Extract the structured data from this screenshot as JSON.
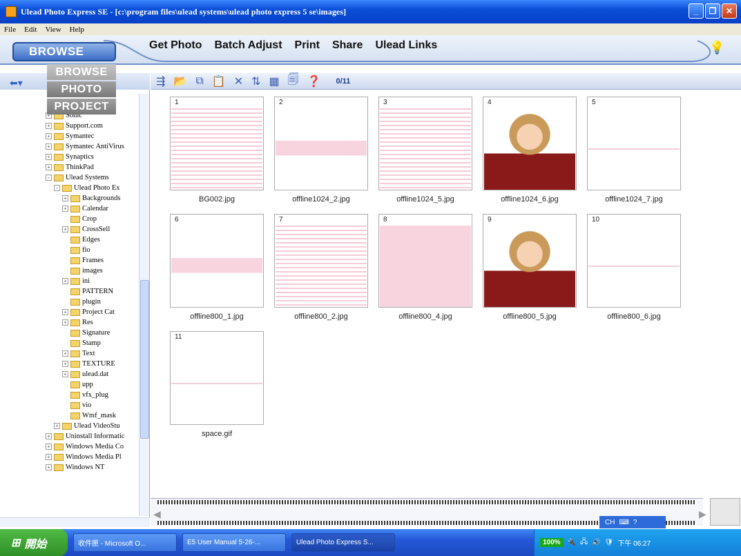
{
  "window": {
    "title": "Ulead Photo Express SE - [c:\\program files\\ulead systems\\ulead photo express 5 se\\images]"
  },
  "menu": [
    "File",
    "Edit",
    "View",
    "Help"
  ],
  "nav": {
    "mode_button": "BROWSE",
    "items": [
      "Get Photo",
      "Batch Adjust",
      "Print",
      "Share",
      "Ulead Links"
    ]
  },
  "mode_menu": [
    "BROWSE",
    "PHOTO",
    "PROJECT"
  ],
  "toolbar": {
    "count": "0/11"
  },
  "tree": [
    {
      "label": "Sonic",
      "indent": 1,
      "pm": "+"
    },
    {
      "label": "Support.com",
      "indent": 1,
      "pm": "+"
    },
    {
      "label": "Symantec",
      "indent": 1,
      "pm": "+"
    },
    {
      "label": "Symantec AntiVirus",
      "indent": 1,
      "pm": "+"
    },
    {
      "label": "Synaptics",
      "indent": 1,
      "pm": "+"
    },
    {
      "label": "ThinkPad",
      "indent": 1,
      "pm": "+"
    },
    {
      "label": "Ulead Systems",
      "indent": 1,
      "pm": "-"
    },
    {
      "label": "Ulead Photo Ex",
      "indent": 2,
      "pm": "-"
    },
    {
      "label": "Backgrounds",
      "indent": 3,
      "pm": "+"
    },
    {
      "label": "Calendar",
      "indent": 3,
      "pm": "+"
    },
    {
      "label": "Crop",
      "indent": 3,
      "pm": ""
    },
    {
      "label": "CrossSell",
      "indent": 3,
      "pm": "+"
    },
    {
      "label": "Edges",
      "indent": 3,
      "pm": ""
    },
    {
      "label": "fio",
      "indent": 3,
      "pm": ""
    },
    {
      "label": "Frames",
      "indent": 3,
      "pm": ""
    },
    {
      "label": "images",
      "indent": 3,
      "pm": ""
    },
    {
      "label": "ini",
      "indent": 3,
      "pm": "+"
    },
    {
      "label": "PATTERN",
      "indent": 3,
      "pm": ""
    },
    {
      "label": "plugin",
      "indent": 3,
      "pm": ""
    },
    {
      "label": "Project Cat",
      "indent": 3,
      "pm": "+"
    },
    {
      "label": "Res",
      "indent": 3,
      "pm": "+"
    },
    {
      "label": "Signature",
      "indent": 3,
      "pm": ""
    },
    {
      "label": "Stamp",
      "indent": 3,
      "pm": ""
    },
    {
      "label": "Text",
      "indent": 3,
      "pm": "+"
    },
    {
      "label": "TEXTURE",
      "indent": 3,
      "pm": "+"
    },
    {
      "label": "ulead.dat",
      "indent": 3,
      "pm": "+"
    },
    {
      "label": "upp",
      "indent": 3,
      "pm": ""
    },
    {
      "label": "vfx_plug",
      "indent": 3,
      "pm": ""
    },
    {
      "label": "vio",
      "indent": 3,
      "pm": ""
    },
    {
      "label": "Wmf_mask",
      "indent": 3,
      "pm": ""
    },
    {
      "label": "Ulead VideoStu",
      "indent": 2,
      "pm": "+"
    },
    {
      "label": "Uninstall Informatic",
      "indent": 1,
      "pm": "+"
    },
    {
      "label": "Windows Media Co",
      "indent": 1,
      "pm": "+"
    },
    {
      "label": "Windows Media Pl",
      "indent": 1,
      "pm": "+"
    },
    {
      "label": "Windows NT",
      "indent": 1,
      "pm": "+"
    }
  ],
  "thumbnails": [
    {
      "num": "1",
      "name": "BG002.jpg",
      "style": "stripes"
    },
    {
      "num": "2",
      "name": "offline1024_2.jpg",
      "style": "banner"
    },
    {
      "num": "3",
      "name": "offline1024_5.jpg",
      "style": "stripes"
    },
    {
      "num": "4",
      "name": "offline1024_6.jpg",
      "style": "face"
    },
    {
      "num": "5",
      "name": "offline1024_7.jpg",
      "style": "blank"
    },
    {
      "num": "6",
      "name": "offline800_1.jpg",
      "style": "banner"
    },
    {
      "num": "7",
      "name": "offline800_2.jpg",
      "style": "stripes"
    },
    {
      "num": "8",
      "name": "offline800_4.jpg",
      "style": "pink"
    },
    {
      "num": "9",
      "name": "offline800_5.jpg",
      "style": "face"
    },
    {
      "num": "10",
      "name": "offline800_6.jpg",
      "style": "blank"
    },
    {
      "num": "11",
      "name": "space.gif",
      "style": "blank"
    }
  ],
  "langbar": "CH",
  "taskbar": {
    "start": "開始",
    "tasks": [
      "收件匣 - Microsoft O...",
      "E5 User Manual 5-26-...",
      "Ulead Photo Express S..."
    ],
    "tray_pct": "100%",
    "clock": "下午 06:27"
  }
}
